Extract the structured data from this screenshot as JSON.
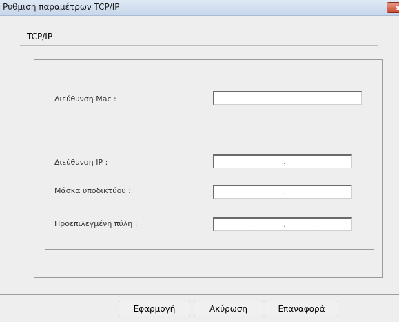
{
  "window": {
    "title": "Ρυθμιση παραμέτρων TCP/IP",
    "close_label": "x"
  },
  "tabs": [
    {
      "label": "TCP/IP"
    }
  ],
  "form": {
    "mac_label": "Διεύθυνση Mac :",
    "mac_value": "",
    "ip_label": "Διεύθυνση IP :",
    "subnet_label": "Μάσκα υποδικτύου :",
    "gateway_label": "Προεπιλεγμένη πύλη :",
    "ip_dot": "."
  },
  "buttons": {
    "apply": "Εφαρμογή",
    "cancel": "Ακύρωση",
    "reset": "Επαναφορά"
  }
}
